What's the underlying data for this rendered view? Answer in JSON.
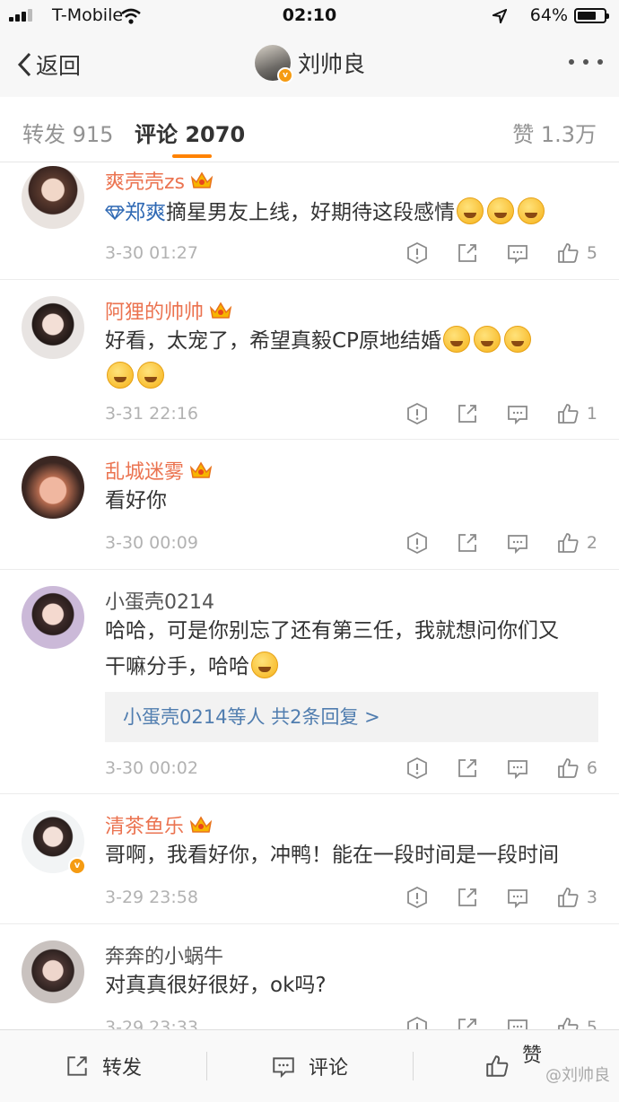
{
  "status": {
    "carrier": "T-Mobile",
    "time": "02:10",
    "battery": "64%"
  },
  "nav": {
    "back_label": "返回",
    "user_name": "刘帅良"
  },
  "tabs": [
    {
      "label": "转发 915"
    },
    {
      "label": "评论 2070"
    },
    {
      "label": "赞 1.3万"
    }
  ],
  "comments": [
    {
      "name": "爽壳壳zs",
      "tag": "郑爽",
      "text": "摘星男友上线，好期待这段感情",
      "time": "3-30 01:27",
      "likes": "5"
    },
    {
      "name": "阿狸的帅帅",
      "text": "好看，太宠了，希望真毅CP原地结婚",
      "time": "3-31 22:16",
      "likes": "1"
    },
    {
      "name": "乱城迷雾",
      "text": "看好你",
      "time": "3-30 00:09",
      "likes": "2"
    },
    {
      "name": "小蛋壳0214",
      "text_line1": "哈哈，可是你别忘了还有第三任，我就想问你们又",
      "text_line2": "干嘛分手，哈哈",
      "reply": "小蛋壳0214等人  共2条回复 >",
      "time": "3-30 00:02",
      "likes": "6"
    },
    {
      "name": "清茶鱼乐",
      "text": "哥啊，我看好你，冲鸭！能在一段时间是一段时间",
      "time": "3-29 23:58",
      "likes": "3"
    },
    {
      "name": "奔奔的小蜗牛",
      "text": "对真真很好很好，ok吗?",
      "time": "3-29 23:33",
      "likes": "5"
    }
  ],
  "bottom": {
    "repost": "转发",
    "comment": "评论",
    "like": "赞",
    "watermark": "@刘帅良"
  },
  "colors": {
    "accent": "#ff8200",
    "name_orange": "#eb7350",
    "link_blue": "#507daf"
  }
}
